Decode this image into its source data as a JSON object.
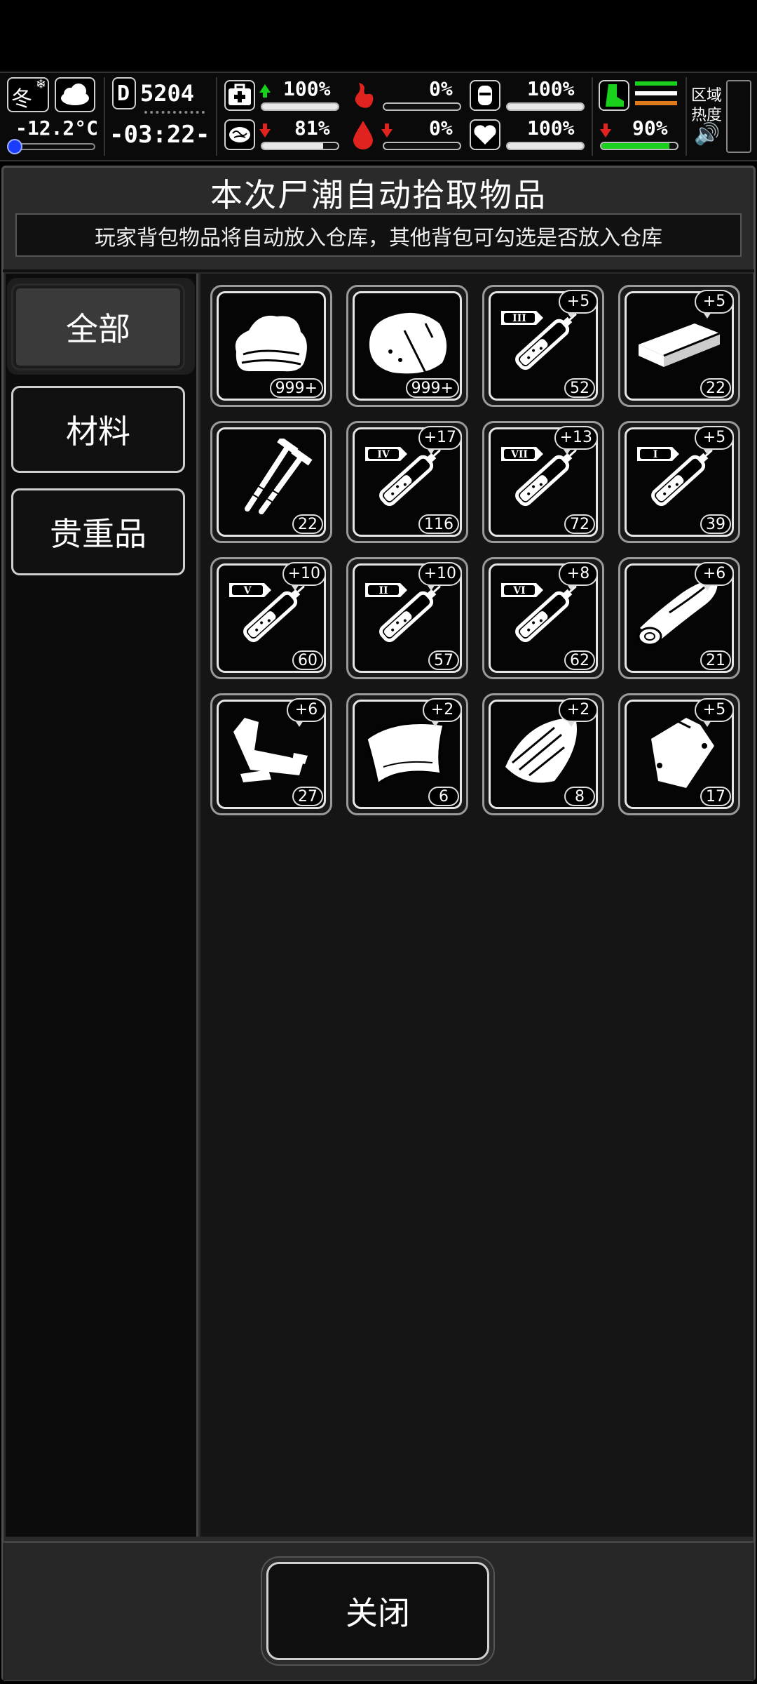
{
  "hud": {
    "season": "冬",
    "temperature": "-12.2°C",
    "day_prefix": "D",
    "day": "5204",
    "time": "-03:22-",
    "health_pct": "100%",
    "health_value": 1.0,
    "hunger_pct": "0%",
    "hunger_value": 0.0,
    "thirst_pct": "100%",
    "thirst_value": 1.0,
    "brain_pct": "81%",
    "brain_value": 0.81,
    "blood_pct": "0%",
    "blood_value": 0.0,
    "heart_pct": "100%",
    "heart_value": 1.0,
    "stamina_pct": "90%",
    "stamina_value": 0.9,
    "area_heat_label_1": "区域",
    "area_heat_label_2": "热度",
    "colors": {
      "up": "#19d11c",
      "down": "#e0231f",
      "boot": "#19d11c",
      "orange": "#e07a1a"
    }
  },
  "panel": {
    "title": "本次尸潮自动拾取物品",
    "subtitle": "玩家背包物品将自动放入仓库，其他背包可勾选是否放入仓库"
  },
  "tabs": [
    {
      "label": "全部",
      "active": true
    },
    {
      "label": "材料",
      "active": false
    },
    {
      "label": "贵重品",
      "active": false
    }
  ],
  "items": [
    {
      "icon": "cloth-icon",
      "count": "999+",
      "plus": ""
    },
    {
      "icon": "sack-icon",
      "count": "999+",
      "plus": ""
    },
    {
      "icon": "syringe-iii-icon",
      "roman": "III",
      "count": "52",
      "plus": "+5"
    },
    {
      "icon": "wood-plank-icon",
      "count": "22",
      "plus": "+5"
    },
    {
      "icon": "nails-icon",
      "count": "22",
      "plus": ""
    },
    {
      "icon": "syringe-iv-icon",
      "roman": "IV",
      "count": "116",
      "plus": "+17"
    },
    {
      "icon": "syringe-vii-icon",
      "roman": "VII",
      "count": "72",
      "plus": "+13"
    },
    {
      "icon": "syringe-i-icon",
      "roman": "I",
      "count": "39",
      "plus": "+5"
    },
    {
      "icon": "syringe-v-icon",
      "roman": "V",
      "count": "60",
      "plus": "+10"
    },
    {
      "icon": "syringe-ii-icon",
      "roman": "II",
      "count": "57",
      "plus": "+10"
    },
    {
      "icon": "syringe-vi-icon",
      "roman": "VI",
      "count": "62",
      "plus": "+8"
    },
    {
      "icon": "log-icon",
      "count": "21",
      "plus": "+6"
    },
    {
      "icon": "scrap-metal-icon",
      "count": "27",
      "plus": "+6"
    },
    {
      "icon": "leather-icon",
      "count": "6",
      "plus": "+2"
    },
    {
      "icon": "bark-icon",
      "count": "8",
      "plus": "+2"
    },
    {
      "icon": "pouch-icon",
      "count": "17",
      "plus": "+5"
    }
  ],
  "close_label": "关闭"
}
